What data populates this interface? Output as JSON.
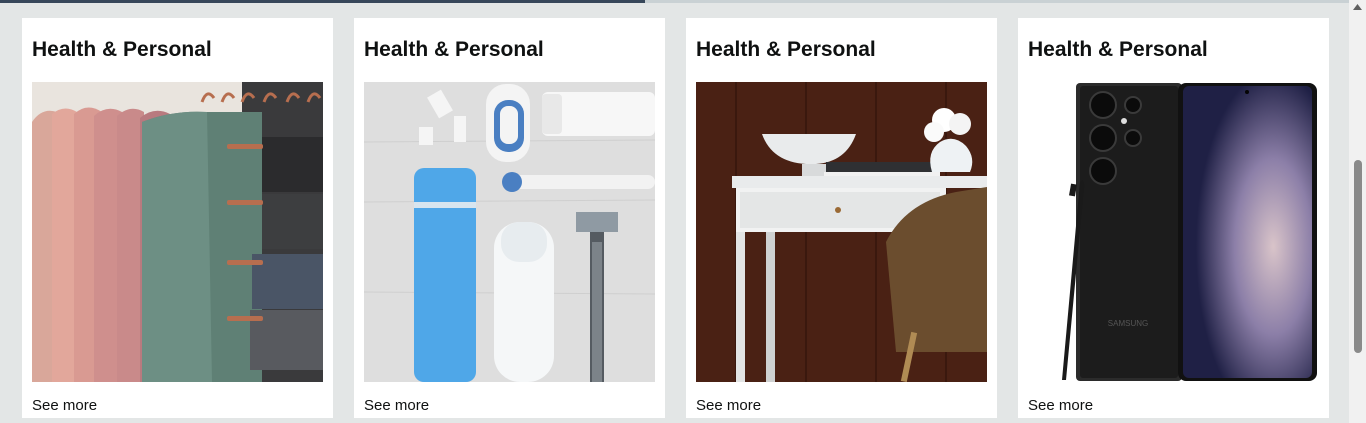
{
  "cards": [
    {
      "title": "Health & Personal",
      "link": "See more",
      "image_icon": "hanging-scarves-image"
    },
    {
      "title": "Health & Personal",
      "link": "See more",
      "image_icon": "toiletries-image"
    },
    {
      "title": "Health & Personal",
      "link": "See more",
      "image_icon": "desk-image"
    },
    {
      "title": "Health & Personal",
      "link": "See more",
      "image_icon": "smartphone-image"
    }
  ],
  "phone_brand": "SAMSUNG",
  "colors": {
    "page_bg": "#e3e6e6",
    "card_bg": "#ffffff",
    "text": "#0f1111"
  }
}
